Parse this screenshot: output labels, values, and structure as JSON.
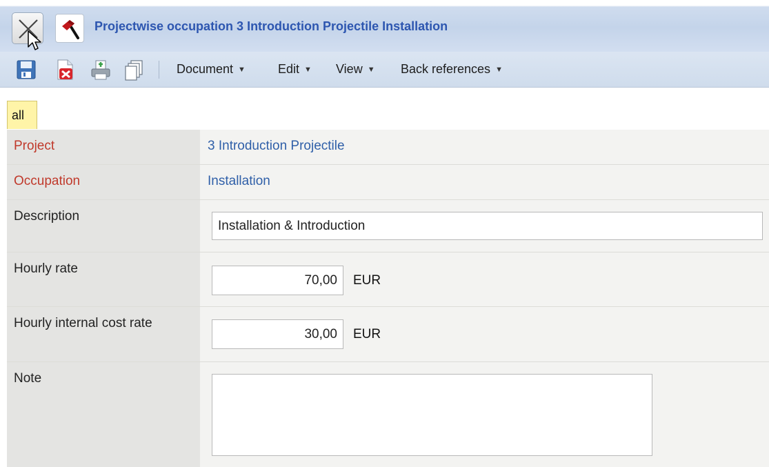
{
  "window": {
    "title": "Projectwise occupation 3 Introduction Projectile Installation"
  },
  "toolbar": {
    "icons": [
      "save-icon",
      "delete-icon",
      "print-icon",
      "copy-icon"
    ],
    "menus": {
      "document": "Document",
      "edit": "Edit",
      "view": "View",
      "back_references": "Back references"
    },
    "caret": "▼"
  },
  "tabs": {
    "all": "all"
  },
  "form": {
    "project": {
      "label": "Project",
      "value": "3 Introduction Projectile"
    },
    "occupation": {
      "label": "Occupation",
      "value": "Installation"
    },
    "description": {
      "label": "Description",
      "value": "Installation & Introduction"
    },
    "hourly_rate": {
      "label": "Hourly rate",
      "value": "70,00",
      "unit": "EUR"
    },
    "hourly_internal_cost_rate": {
      "label": "Hourly internal cost rate",
      "value": "30,00",
      "unit": "EUR"
    },
    "note": {
      "label": "Note",
      "value": ""
    }
  },
  "colors": {
    "title_text": "#2d56b0",
    "required_label": "#c0392b",
    "link_value": "#2f5fa8",
    "active_tab": "#fff4a8"
  }
}
